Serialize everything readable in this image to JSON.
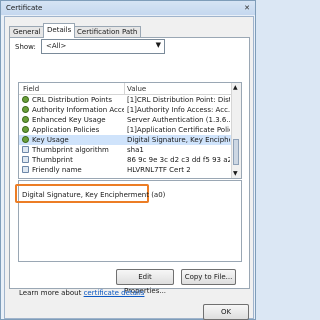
{
  "window": {
    "title": "Certificate",
    "close_glyph": "✕"
  },
  "tabs": [
    {
      "label": "General"
    },
    {
      "label": "Details",
      "active": true
    },
    {
      "label": "Certification Path"
    }
  ],
  "show": {
    "label": "Show:",
    "value": "<All>"
  },
  "list": {
    "columns": [
      "Field",
      "Value"
    ],
    "rows": [
      {
        "field": "CRL Distribution Points",
        "value": "[1]CRL Distribution Point: Distr...",
        "icon": "certificate-extension-icon"
      },
      {
        "field": "Authority Information Access",
        "value": "[1]Authority Info Access: Acc...",
        "icon": "certificate-extension-icon"
      },
      {
        "field": "Enhanced Key Usage",
        "value": "Server Authentication (1.3.6....",
        "icon": "certificate-extension-icon"
      },
      {
        "field": "Application Policies",
        "value": "[1]Application Certificate Polic...",
        "icon": "certificate-extension-icon"
      },
      {
        "field": "Key Usage",
        "value": "Digital Signature, Key Encipher...",
        "icon": "certificate-extension-icon",
        "selected": true
      },
      {
        "field": "Thumbprint algorithm",
        "value": "sha1",
        "icon": "document-icon"
      },
      {
        "field": "Thumbprint",
        "value": "86 9c 9e 3c d2 c3 dd f5 93 a2 ...",
        "icon": "document-icon"
      },
      {
        "field": "Friendly name",
        "value": "HLVRNL7TF Cert 2",
        "icon": "document-icon"
      }
    ]
  },
  "detail_text": "Digital Signature, Key Encipherment (a0)",
  "buttons": {
    "edit_properties": "Edit Properties...",
    "copy_to_file": "Copy to File...",
    "ok": "OK"
  },
  "learn_more": {
    "prefix": "Learn more about ",
    "link": "certificate details"
  },
  "colors": {
    "highlight_border": "#ec7d25",
    "selection": "#cfe3fb",
    "link": "#0b57c2"
  }
}
